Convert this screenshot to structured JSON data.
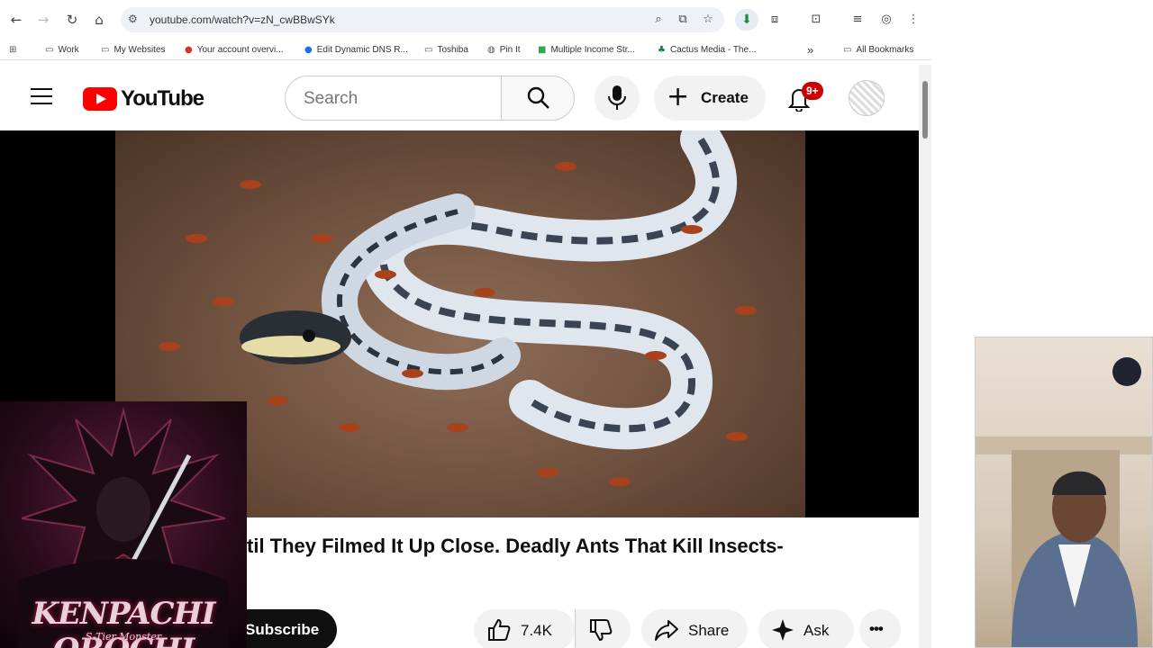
{
  "browser": {
    "url": "youtube.com/watch?v=zN_cwBBwSYk",
    "bookmarks": [
      "Work",
      "My Websites",
      "Your account overvi...",
      "Edit Dynamic DNS R...",
      "Toshiba",
      "Pin It",
      "Multiple Income Str...",
      "Cactus Media - The..."
    ],
    "more_bookmarks": "»",
    "all_bookmarks": "All Bookmarks"
  },
  "youtube": {
    "logo_text": "YouTube",
    "search_placeholder": "Search",
    "create_label": "Create",
    "notification_badge": "9+"
  },
  "video": {
    "title": "til They Filmed It Up Close. Deadly Ants That Kill Insects-",
    "subscribe_label": "Subscribe",
    "like_count": "7.4K",
    "share_label": "Share",
    "ask_label": "Ask",
    "more_label": "•••"
  },
  "album_overlay": {
    "name": "KENPACHI OROCHI",
    "subtitle": "S-Tier Monster"
  },
  "colors": {
    "youtube_red": "#ff0000",
    "badge_red": "#cc0000",
    "subscribe_bg": "#0f0f0f"
  }
}
